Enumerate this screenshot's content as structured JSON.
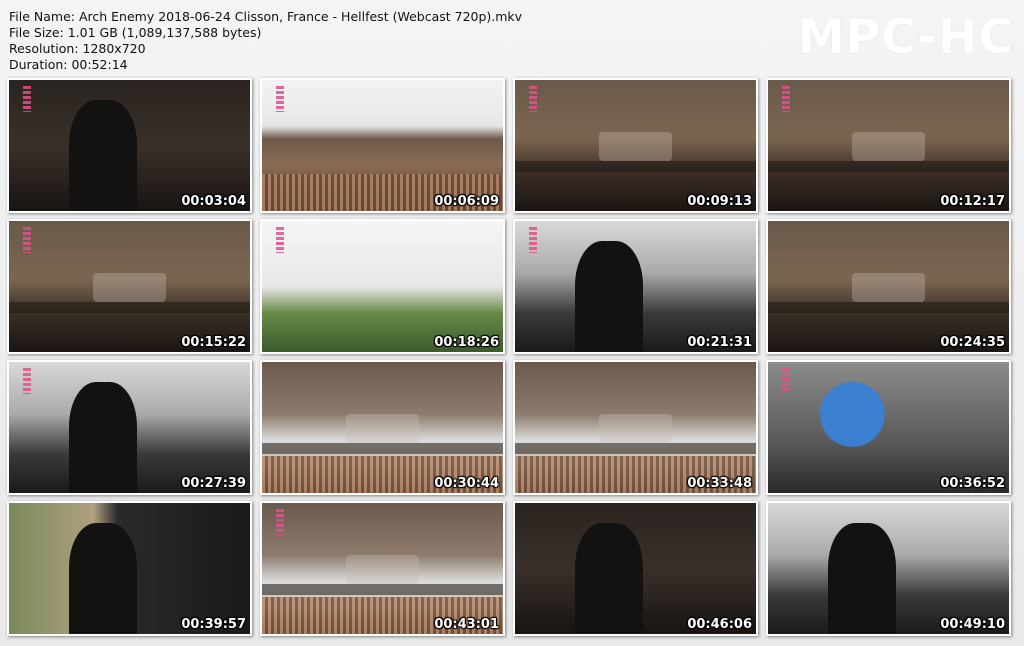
{
  "info": {
    "file_name": "File Name: Arch Enemy 2018-06-24 Clisson, France - Hellfest (Webcast 720p).mkv",
    "file_size": "File Size: 1.01 GB (1,089,137,588 bytes)",
    "resolution": "Resolution: 1280x720",
    "duration": "Duration: 00:52:14"
  },
  "logo": "MPC-HC",
  "thumbnails": [
    {
      "time": "00:03:04",
      "scene": "dark",
      "badge": true
    },
    {
      "time": "00:06:09",
      "scene": "crowd",
      "badge": true
    },
    {
      "time": "00:09:13",
      "scene": "stage",
      "badge": true
    },
    {
      "time": "00:12:17",
      "scene": "stage",
      "badge": true
    },
    {
      "time": "00:15:22",
      "scene": "stage",
      "badge": true
    },
    {
      "time": "00:18:26",
      "scene": "sky",
      "badge": true
    },
    {
      "time": "00:21:31",
      "scene": "drum",
      "badge": true
    },
    {
      "time": "00:24:35",
      "scene": "stage",
      "badge": false
    },
    {
      "time": "00:27:39",
      "scene": "drum",
      "badge": true
    },
    {
      "time": "00:30:44",
      "scene": "smoke",
      "badge": false
    },
    {
      "time": "00:33:48",
      "scene": "smoke",
      "badge": false
    },
    {
      "time": "00:36:52",
      "scene": "blue",
      "badge": true
    },
    {
      "time": "00:39:57",
      "scene": "guitar",
      "badge": false
    },
    {
      "time": "00:43:01",
      "scene": "smoke",
      "badge": true
    },
    {
      "time": "00:46:06",
      "scene": "dark",
      "badge": false
    },
    {
      "time": "00:49:10",
      "scene": "drum",
      "badge": false
    }
  ]
}
